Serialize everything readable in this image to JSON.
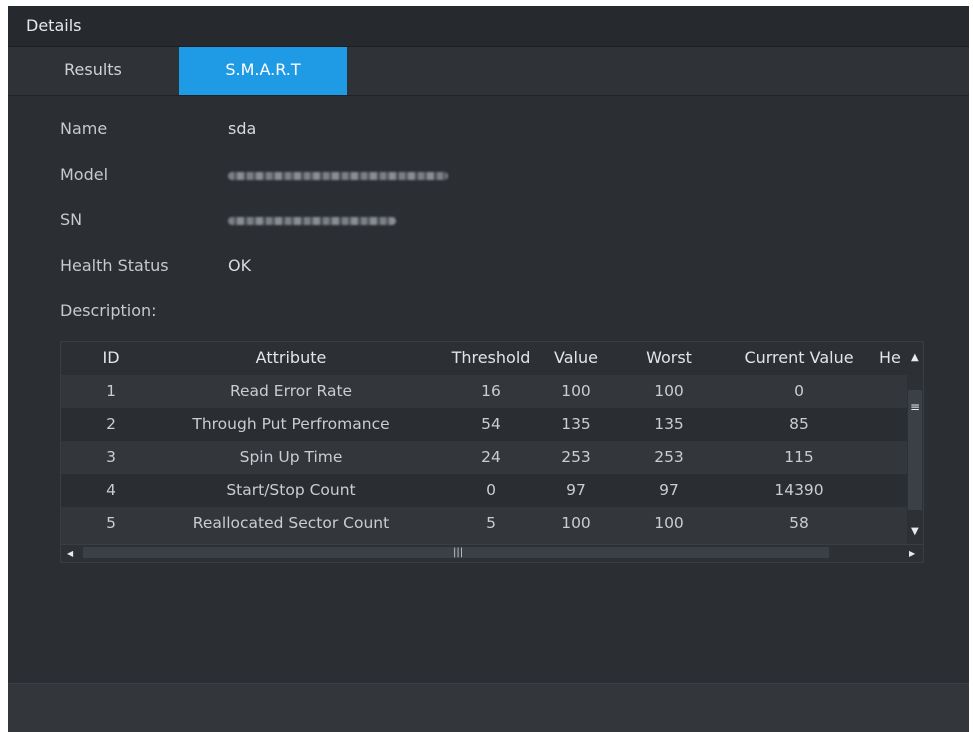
{
  "window": {
    "title": "Details"
  },
  "tabs": [
    {
      "label": "Results",
      "active": false
    },
    {
      "label": "S.M.A.R.T",
      "active": true
    }
  ],
  "info": {
    "name_label": "Name",
    "name_value": "sda",
    "model_label": "Model",
    "sn_label": "SN",
    "health_label": "Health Status",
    "health_value": "OK",
    "description_label": "Description:"
  },
  "table": {
    "columns": [
      "ID",
      "Attribute",
      "Threshold",
      "Value",
      "Worst",
      "Current Value",
      "He"
    ],
    "rows": [
      [
        "1",
        "Read Error Rate",
        "16",
        "100",
        "100",
        "0"
      ],
      [
        "2",
        "Through Put Perfromance",
        "54",
        "135",
        "135",
        "85"
      ],
      [
        "3",
        "Spin Up Time",
        "24",
        "253",
        "253",
        "115"
      ],
      [
        "4",
        "Start/Stop Count",
        "0",
        "97",
        "97",
        "14390"
      ],
      [
        "5",
        "Reallocated Sector Count",
        "5",
        "100",
        "100",
        "58"
      ]
    ]
  },
  "colors": {
    "accent": "#1f9be5",
    "background": "#2b2e33"
  },
  "icons": {
    "scroll_up": "▲",
    "scroll_down": "▼",
    "scroll_left": "◀",
    "scroll_right": "▶",
    "vgrip": "≡",
    "hgrip": "|||"
  }
}
